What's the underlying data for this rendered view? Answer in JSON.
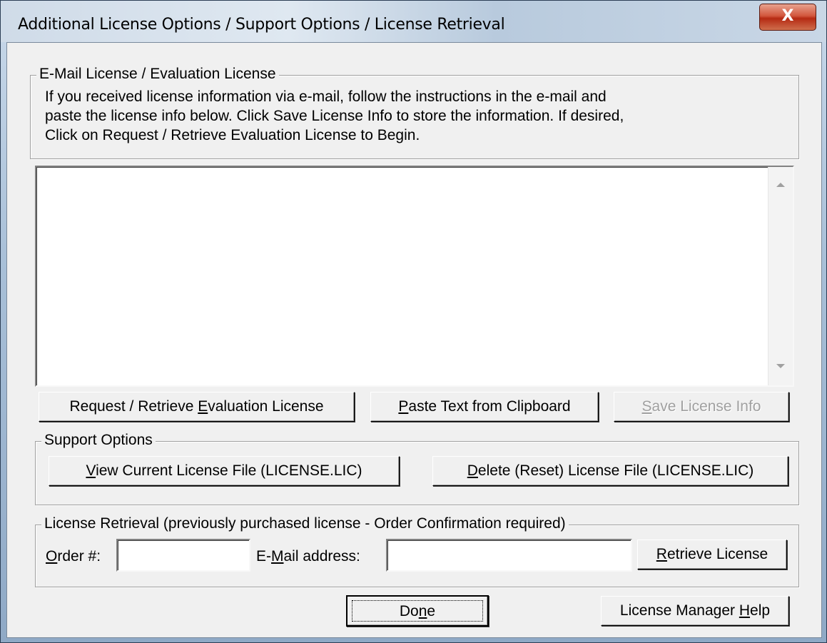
{
  "window": {
    "title": "Additional License Options / Support Options / License Retrieval",
    "close_glyph": "X"
  },
  "email_group": {
    "legend": "E-Mail License / Evaluation License",
    "instructions": [
      "If you received license information via e-mail, follow the instructions in the e-mail and",
      "paste the license info below. Click Save License Info to store the information.  If desired,",
      "Click on Request / Retrieve Evaluation License to Begin."
    ],
    "license_text": ""
  },
  "buttons": {
    "request_eval_pre": "Request / Retrieve ",
    "request_eval_key": "E",
    "request_eval_post": "valuation License",
    "paste_key": "P",
    "paste_post": "aste Text from Clipboard",
    "save_key": "S",
    "save_post": "ave License Info",
    "view_key": "V",
    "view_post": "iew Current License File (LICENSE.LIC)",
    "delete_key": "D",
    "delete_post": "elete (Reset) License File (LICENSE.LIC)",
    "retrieve_key": "R",
    "retrieve_post": "etrieve License",
    "done_pre": "Do",
    "done_key": "n",
    "done_post": "e",
    "help_pre": "License Manager ",
    "help_key": "H",
    "help_post": "elp"
  },
  "support_group": {
    "legend": "Support Options"
  },
  "retrieval_group": {
    "legend": "License Retrieval (previously purchased license - Order Confirmation required)",
    "order_label_key": "O",
    "order_label_post": "rder #:",
    "order_value": "",
    "email_label_pre": "E-",
    "email_label_key": "M",
    "email_label_post": "ail address:",
    "email_value": ""
  },
  "colors": {
    "dialog_bg": "#f0f0f0",
    "disabled_text": "#a0a0a0",
    "close_button": "#c7402a"
  },
  "icons": {
    "close": "close-icon",
    "scroll_up": "scroll-up-arrow-icon",
    "scroll_down": "scroll-down-arrow-icon"
  }
}
